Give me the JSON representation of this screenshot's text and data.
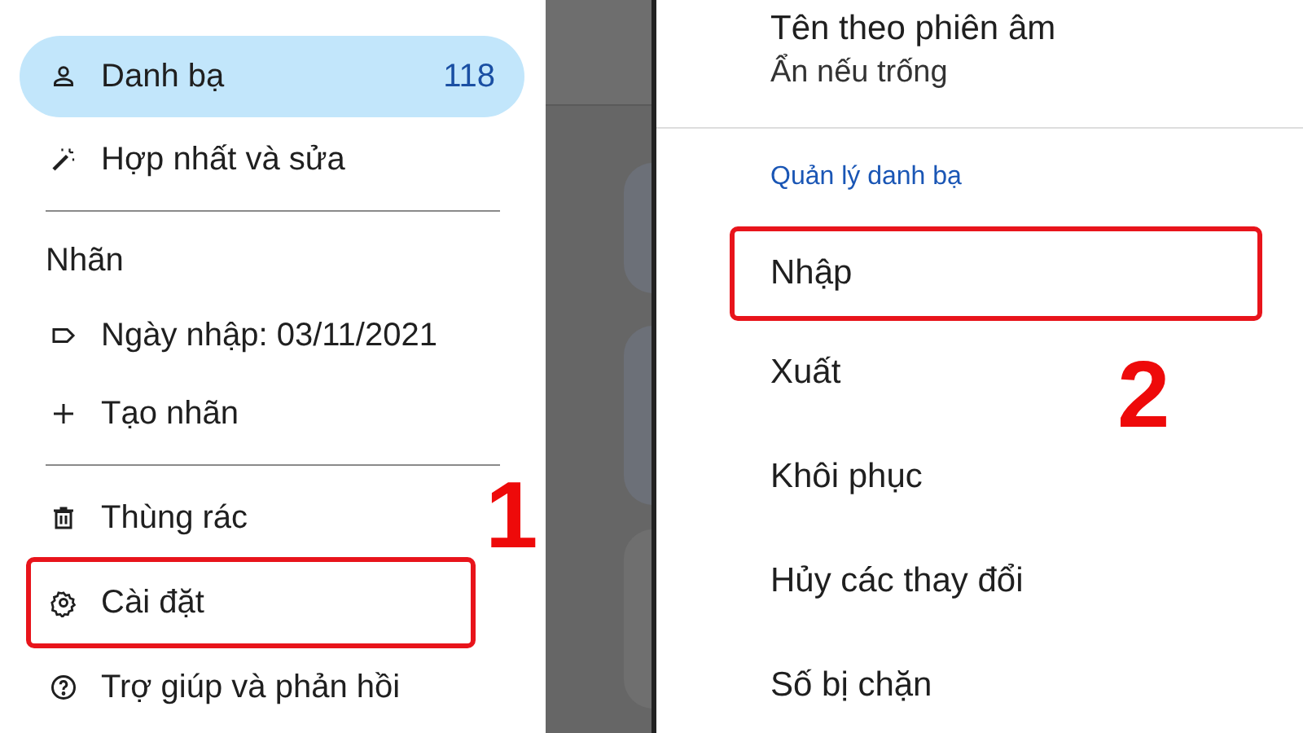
{
  "left_drawer": {
    "step_label": "1",
    "items": [
      {
        "kind": "nav",
        "label": "Danh bạ",
        "count": "118",
        "selected": true,
        "highlighted": false
      },
      {
        "kind": "nav",
        "label": "Hợp nhất và sửa",
        "selected": false,
        "highlighted": false
      },
      {
        "kind": "divider"
      },
      {
        "kind": "header",
        "label": "Nhãn"
      },
      {
        "kind": "nav",
        "label": "Ngày nhập: 03/11/2021",
        "selected": false,
        "highlighted": false
      },
      {
        "kind": "nav",
        "label": "Tạo nhãn",
        "selected": false,
        "highlighted": false
      },
      {
        "kind": "divider"
      },
      {
        "kind": "nav",
        "label": "Thùng rác",
        "selected": false,
        "highlighted": false
      },
      {
        "kind": "nav",
        "label": "Cài đặt",
        "selected": false,
        "highlighted": true
      },
      {
        "kind": "nav",
        "label": "Trợ giúp và phản hồi",
        "selected": false,
        "highlighted": false
      }
    ]
  },
  "settings": {
    "step_label": "2",
    "items": [
      {
        "kind": "setting",
        "label": "Tên theo phiên âm",
        "value": "Ẩn nếu trống",
        "highlighted": false
      },
      {
        "kind": "divider"
      },
      {
        "kind": "header",
        "label": "Quản lý danh bạ"
      },
      {
        "kind": "setting",
        "label": "Nhập",
        "highlighted": true
      },
      {
        "kind": "setting",
        "label": "Xuất",
        "highlighted": false
      },
      {
        "kind": "setting",
        "label": "Khôi phục",
        "highlighted": false
      },
      {
        "kind": "setting",
        "label": "Hủy các thay đổi",
        "highlighted": false
      },
      {
        "kind": "setting",
        "label": "Số bị chặn",
        "highlighted": false
      }
    ]
  }
}
